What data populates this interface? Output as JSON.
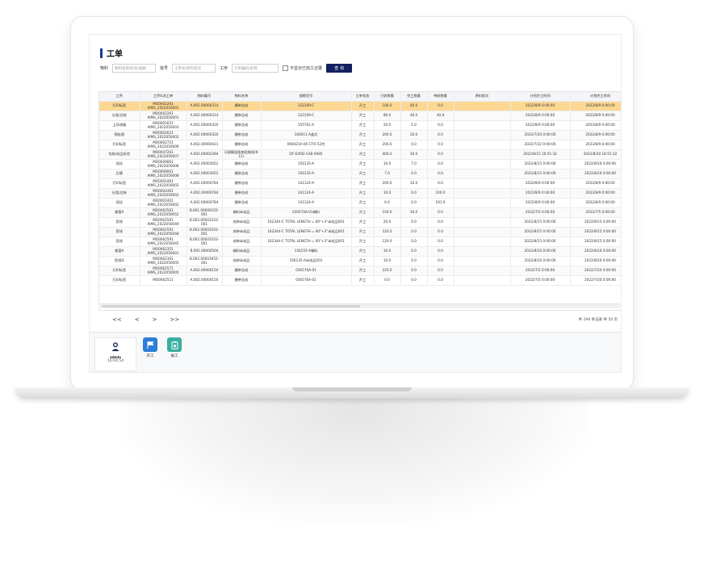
{
  "page": {
    "title": "工单"
  },
  "filters": {
    "material_label": "物料",
    "material_placeholder": "物料名称/料号/规格",
    "batch_label": "批号",
    "batch_placeholder": "工单号/原料批次",
    "step_label": "工序",
    "step_placeholder": "工单编码/名称",
    "hide_completed_label": "不显示已完工记录",
    "query_label": "查 询"
  },
  "table": {
    "columns": [
      "工序",
      "工序&派工单",
      "物料编号",
      "物料名称",
      "规格型号",
      "工单状态",
      "已收数量",
      "完工数量",
      "待收数量",
      "原料批次",
      "计划开工时间",
      "计划完工时间"
    ],
    "rows": [
      [
        "打印标签",
        "MO0002261 AIMS_2022050001",
        "A.002.00000314",
        "缠带总成",
        "122109-C",
        "开工",
        "100.0",
        "40.0",
        "0.0",
        "",
        "2022/8/9 0:00:00",
        "2022/8/9 0:00:00"
      ],
      [
        "分类/总装",
        "MO0002261 AIMS_2022050001",
        "A.002.00000314",
        "缠带总成",
        "122109-C",
        "开工",
        "80.0",
        "40.0",
        "40.0",
        "",
        "2022/8/9 0:00:00",
        "2022/8/9 0:00:00"
      ],
      [
        "上导线端",
        "MO0001651 AIMS_2022050003",
        "A.002.00000320",
        "缠带总成",
        "155761-A",
        "开工",
        "20.0",
        "5.0",
        "0.0",
        "",
        "2022/8/9 0:00:00",
        "2022/8/9 0:00:00"
      ],
      [
        "预处理",
        "MO0002621 AIMS_2022050002",
        "A.002.00000320",
        "缠带总成",
        "160011-A盖式",
        "开工",
        "200.0",
        "20.0",
        "0.0",
        "",
        "2022/7/20 0:00:00",
        "2022/8/9 0:00:00"
      ],
      [
        "打印标签",
        "MO0002721 AIMS_2022050009",
        "A.002.00000421",
        "缠带总成",
        "090021A-00 CTO-52芯",
        "开工",
        "200.0",
        "0.0",
        "0.0",
        "",
        "2022/7/22 0:00:00",
        "2022/8/9 0:00:00"
      ],
      [
        "包装/成品检验",
        "MO0047261 AIMS_2022050007",
        "A.002.00002394",
        "马德模组线束组装线(K-11)",
        "DF-EVRD-CAB-0085",
        "开工",
        "400.0",
        "30.0",
        "0.0",
        "",
        "2022/8/15 16:51:32",
        "2022/8/20 16:51:32"
      ],
      [
        "测试",
        "MO0009061 AIMS_2022050008",
        "A.002.00003052",
        "缠带总成",
        "156135-A",
        "开工",
        "10.0",
        "7.0",
        "0.0",
        "",
        "2022/8/15 0:00:00",
        "2022/8/16 0:00:00"
      ],
      [
        "压模",
        "MO0009061 AIMS_2022050008",
        "A.002.00003052",
        "缠带总成",
        "156135-A",
        "开工",
        "7.0",
        "0.0",
        "0.0",
        "",
        "2022/8/15 0:00:00",
        "2022/8/16 0:00:00"
      ],
      [
        "打印标签",
        "MO0002461 AIMS_2022050002",
        "A.002.00000784",
        "缠带总成",
        "141124-A",
        "开工",
        "200.0",
        "10.0",
        "0.0",
        "",
        "2022/8/9 0:00:00",
        "2022/8/9 0:00:00"
      ],
      [
        "分类/总装",
        "MO0002461 AIMS_2022050002",
        "A.002.00000784",
        "缠带总成",
        "141124-A",
        "开工",
        "10.0",
        "0.0",
        "100.0",
        "",
        "2022/8/9 0:00:00",
        "2022/8/9 0:00:00"
      ],
      [
        "测试",
        "MO0002461 AIMS_2022050002",
        "A.002.00000784",
        "缠带总成",
        "141124-A",
        "开工",
        "0.0",
        "0.0",
        "191.0",
        "",
        "2022/8/9 0:00:00",
        "2022/8/9 0:00:00"
      ],
      [
        "裁管A",
        "MO0062561 AIMS_2022050052",
        "B.001.00000103-001",
        "辅料半成品",
        "030570A-01辅料",
        "开工",
        "150.0",
        "10.0",
        "0.0",
        "",
        "2022/7/5 0:00:00",
        "2022/7/5 0:00:00"
      ],
      [
        "剪线",
        "MO0062591 AIMS_2022050049",
        "B.002.00003103-001",
        "成带半成品",
        "162344-C TOTAL LENGTH = 60\"+3\"半成品001",
        "开工",
        "20.0",
        "0.0",
        "0.0",
        "",
        "2022/8/15 0:00:00",
        "2022/8/15 0:00:00"
      ],
      [
        "剪线",
        "MO0062591 AIMS_2022050048",
        "B.002.00003103-001",
        "成带半成品",
        "162344-C TOTAL LENGTH = 60\"+3\"半成品001",
        "开工",
        "120.0",
        "0.0",
        "0.0",
        "",
        "2022/8/15 0:00:00",
        "2022/8/15 0:00:00"
      ],
      [
        "剪线",
        "MO0062591 AIMS_2022050045",
        "B.002.00003103-001",
        "成带半成品",
        "162344-C TOTAL LENGTH = 60\"+3\"半成品001",
        "开工",
        "120.0",
        "0.0",
        "0.0",
        "",
        "2022/8/15 0:00:00",
        "2022/8/15 0:00:00"
      ],
      [
        "裁管A",
        "MO0062351 AIMS_2022050001",
        "B.001.00000504",
        "辅料半成品",
        "156155-A辅料",
        "开工",
        "10.0",
        "0.0",
        "0.0",
        "",
        "2022/8/16 0:00:00",
        "2022/8/16 0:00:00"
      ],
      [
        "剪线D",
        "MO0062361 AIMS_2022050005",
        "B.002.00003052-001",
        "成带半成品",
        "156135-A半成品001",
        "开工",
        "10.0",
        "0.0",
        "0.0",
        "",
        "2022/8/16 0:00:00",
        "2022/8/16 0:00:00"
      ],
      [
        "打印标签",
        "MO0062571 AIMS_2022050005",
        "A.002.00000150",
        "缠带总成",
        "030570A-01",
        "开工",
        "220.0",
        "0.0",
        "0.0",
        "",
        "2022/7/5 0:00:00",
        "2022/7/20 0:00:00"
      ],
      [
        "打印标签",
        "MO0062511",
        "A.002.00000150",
        "缠带总成",
        "030570A-01",
        "开工",
        "0.0",
        "0.0",
        "0.0",
        "",
        "2022/7/5 0:00:00",
        "2022/7/20 0:00:00"
      ]
    ]
  },
  "pager": {
    "first": "<<",
    "prev": "<",
    "next": ">",
    "last": ">>",
    "summary": "共 194 条记录  共 10 页"
  },
  "footer": {
    "user_name": "admin",
    "user_time": "10:04:54",
    "start_label": "开工",
    "report_label": "报工",
    "colors": {
      "start": "#2b7fd8",
      "report": "#3aaea0"
    }
  }
}
